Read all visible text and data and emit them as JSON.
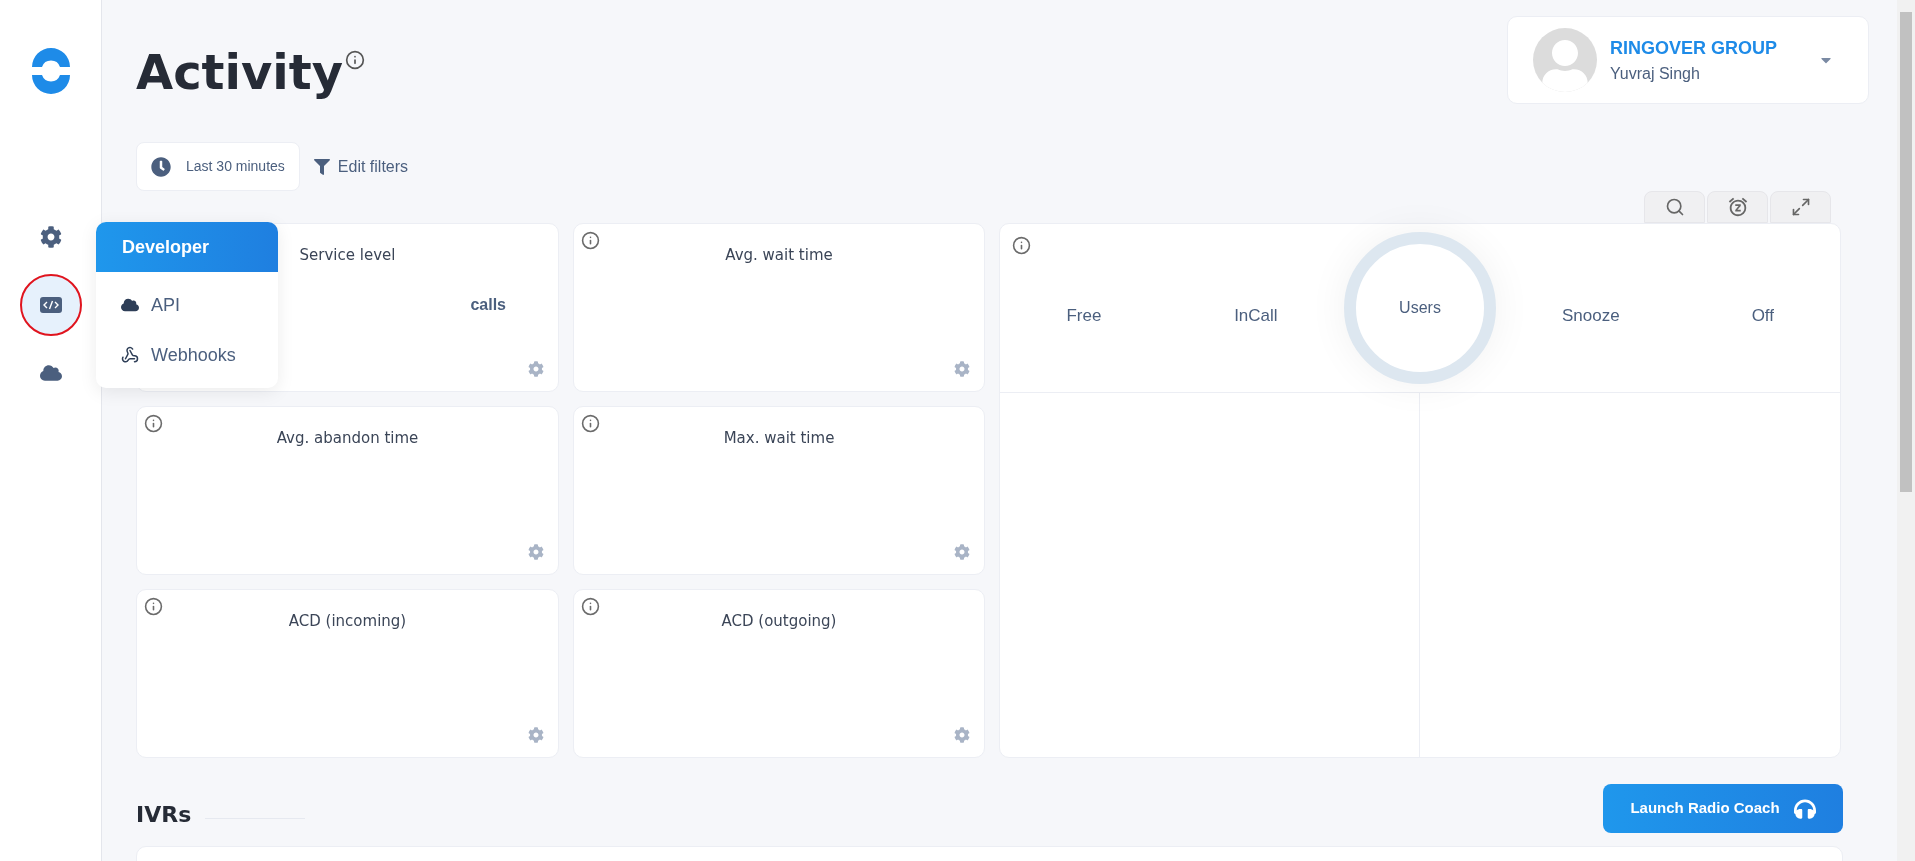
{
  "sidebar": {
    "items": [
      {
        "kind": "settings",
        "selected": false
      },
      {
        "kind": "code",
        "selected": true
      },
      {
        "kind": "cloud",
        "selected": false
      }
    ]
  },
  "page_title": "Activity",
  "time_filter": "Last 30 minutes",
  "edit_filters": "Edit filters",
  "profile": {
    "company": "RINGOVER GROUP",
    "user": "Yuvraj Singh"
  },
  "developer_menu": {
    "title": "Developer",
    "items": [
      {
        "label": "API",
        "kind": "cloud"
      },
      {
        "label": "Webhooks",
        "kind": "webhook"
      }
    ]
  },
  "stat_cards": [
    {
      "title": "Service level",
      "value": "calls"
    },
    {
      "title": "Avg. wait time"
    },
    {
      "title": "Avg. abandon time"
    },
    {
      "title": "Max. wait time"
    },
    {
      "title": "ACD (incoming)"
    },
    {
      "title": "ACD (outgoing)"
    }
  ],
  "users_panel": {
    "statuses_left": [
      "Free",
      "InCall"
    ],
    "center": "Users",
    "statuses_right": [
      "Snooze",
      "Off"
    ]
  },
  "section_title": "IVRs",
  "launch_button": "Launch Radio Coach"
}
